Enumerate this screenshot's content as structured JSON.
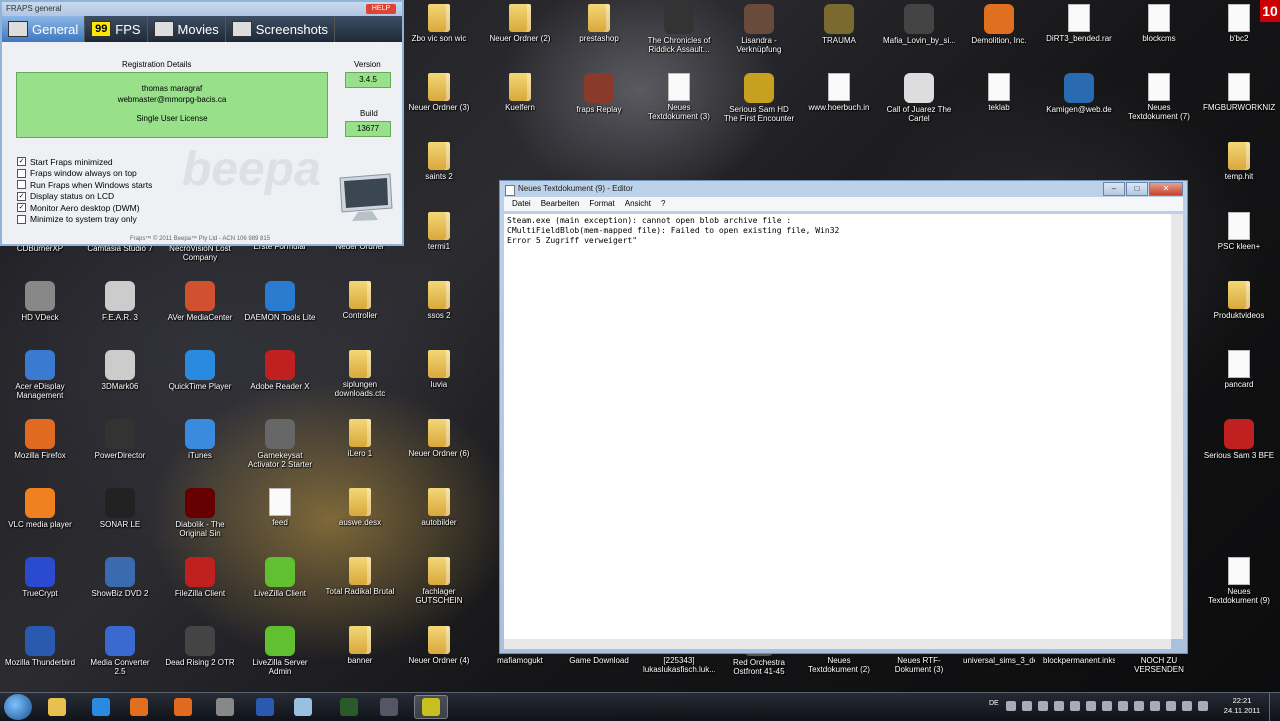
{
  "fraps": {
    "title": "FRAPS general",
    "help": "HELP",
    "version_tag": "v3.4.5",
    "tabs": [
      {
        "label": "General"
      },
      {
        "label": "FPS",
        "icon_text": "99"
      },
      {
        "label": "Movies"
      },
      {
        "label": "Screenshots"
      }
    ],
    "registration_heading": "Registration Details",
    "reg_name": "thomas maragraf",
    "reg_email": "webmaster@mmorpg-bacis.ca",
    "license": "Single User License",
    "version_label": "Version",
    "version_value": "3.4.5",
    "build_label": "Build",
    "build_value": "13677",
    "watermark": "beepa",
    "options": [
      {
        "label": "Start Fraps minimized",
        "checked": true
      },
      {
        "label": "Fraps window always on top",
        "checked": false
      },
      {
        "label": "Run Fraps when Windows starts",
        "checked": false
      },
      {
        "label": "Display status on LCD",
        "checked": true
      },
      {
        "label": "Monitor Aero desktop (DWM)",
        "checked": true
      },
      {
        "label": "Minimize to system tray only",
        "checked": false
      }
    ],
    "copyright": "Fraps™ © 2011 Beepa™ Pty Ltd - ACN 106 989 815"
  },
  "notepad": {
    "title": "Neues Textdokument (9) - Editor",
    "menu": [
      "Datei",
      "Bearbeiten",
      "Format",
      "Ansicht",
      "?"
    ],
    "lines": [
      "Steam.exe (main exception): cannot open blob archive file :",
      "CMultiFieldBlob(mem-mapped file): Failed to open existing file, Win32",
      "Error 5 Zugriff verweigert\""
    ],
    "controls": {
      "minimize": "–",
      "maximize": "□",
      "close": "✕"
    }
  },
  "desktop_icons": [
    {
      "label": "Zbo vic son wic",
      "kind": "folder"
    },
    {
      "label": "Neuer Ordner (2)",
      "kind": "folder"
    },
    {
      "label": "prestashop",
      "kind": "folder"
    },
    {
      "label": "The Chronicles of Riddick Assault...",
      "kind": "app",
      "color": "#333"
    },
    {
      "label": "Lisandra - Verknüpfung",
      "kind": "app",
      "color": "#6a4a3a"
    },
    {
      "label": "TRAUMA",
      "kind": "app",
      "color": "#7a6a30"
    },
    {
      "label": "Mafia_Lovin_by_si...",
      "kind": "app",
      "color": "#444"
    },
    {
      "label": "Demolition, Inc.",
      "kind": "app",
      "color": "#e07020"
    },
    {
      "label": "DiRT3_bended.rar",
      "kind": "doc"
    },
    {
      "label": "blockcms",
      "kind": "doc"
    },
    {
      "label": "b'bc2",
      "kind": "doc"
    },
    {
      "label": "Neuer Ordner (3)",
      "kind": "folder"
    },
    {
      "label": "Kuelfern",
      "kind": "folder"
    },
    {
      "label": "fraps Replay",
      "kind": "app",
      "color": "#8a3a2a"
    },
    {
      "label": "Neues Textdokument (3)",
      "kind": "doc"
    },
    {
      "label": "Serious Sam HD The First Encounter",
      "kind": "app",
      "color": "#c8a020"
    },
    {
      "label": "www.hoerbuch.in",
      "kind": "doc"
    },
    {
      "label": "Call of Juarez The Cartel",
      "kind": "app",
      "color": "#ddd"
    },
    {
      "label": "teklab",
      "kind": "doc"
    },
    {
      "label": "Kamigen@web.de",
      "kind": "app",
      "color": "#2a6ab0"
    },
    {
      "label": "Neues Textdokument (7)",
      "kind": "doc"
    },
    {
      "label": "FMGBURWORKNIZE...",
      "kind": "doc"
    },
    {
      "label": "saints 2",
      "kind": "folder"
    },
    {
      "label": "temp.hit",
      "kind": "folder"
    },
    {
      "label": "CDBurnerXP",
      "kind": "app",
      "color": "#555"
    },
    {
      "label": "Camtasia Studio 7",
      "kind": "app",
      "color": "#2a7a3a"
    },
    {
      "label": "NecroVisioN Lost Company",
      "kind": "app",
      "color": "#553"
    },
    {
      "label": "Erste Formular",
      "kind": "doc"
    },
    {
      "label": "Neuer Ordner",
      "kind": "folder"
    },
    {
      "label": "termi1",
      "kind": "folder"
    },
    {
      "label": "PSC kleen+",
      "kind": "doc"
    },
    {
      "label": "HD VDeck",
      "kind": "app",
      "color": "#888"
    },
    {
      "label": "F.E.A.R. 3",
      "kind": "app",
      "color": "#ccc"
    },
    {
      "label": "AVer MediaCenter",
      "kind": "app",
      "color": "#d05030"
    },
    {
      "label": "DAEMON Tools Lite",
      "kind": "app",
      "color": "#2a7ad0"
    },
    {
      "label": "Controller",
      "kind": "folder"
    },
    {
      "label": "ssos 2",
      "kind": "folder"
    },
    {
      "label": "Produktvideos",
      "kind": "folder"
    },
    {
      "label": "Acer eDisplay Management",
      "kind": "app",
      "color": "#3a7ad0"
    },
    {
      "label": "3DMark06",
      "kind": "app",
      "color": "#ccc"
    },
    {
      "label": "QuickTime Player",
      "kind": "app",
      "color": "#2a8ae0"
    },
    {
      "label": "Adobe Reader X",
      "kind": "app",
      "color": "#c02020"
    },
    {
      "label": "siplungen downloads.ctc",
      "kind": "folder"
    },
    {
      "label": "luvia",
      "kind": "folder"
    },
    {
      "label": "pancard",
      "kind": "doc"
    },
    {
      "label": "Mozilla Firefox",
      "kind": "app",
      "color": "#e06a20"
    },
    {
      "label": "PowerDirector",
      "kind": "app",
      "color": "#333"
    },
    {
      "label": "iTunes",
      "kind": "app",
      "color": "#3a8ae0"
    },
    {
      "label": "Gamekeysat Activator 2 Starter",
      "kind": "app",
      "color": "#666"
    },
    {
      "label": "iLero 1",
      "kind": "folder"
    },
    {
      "label": "Neuer Ordner (6)",
      "kind": "folder"
    },
    {
      "label": "Serious Sam 3 BFE",
      "kind": "app",
      "color": "#c02020"
    },
    {
      "label": "VLC media player",
      "kind": "app",
      "color": "#f08020"
    },
    {
      "label": "SONAR LE",
      "kind": "app",
      "color": "#222"
    },
    {
      "label": "Diabolik - The Original Sin",
      "kind": "app",
      "color": "#600"
    },
    {
      "label": "feed",
      "kind": "doc"
    },
    {
      "label": "auswe.desx",
      "kind": "folder"
    },
    {
      "label": "autobilder",
      "kind": "folder"
    },
    {
      "label": "TrueCrypt",
      "kind": "app",
      "color": "#2a4ad0"
    },
    {
      "label": "ShowBiz DVD 2",
      "kind": "app",
      "color": "#3a6ab0"
    },
    {
      "label": "FileZilla Client",
      "kind": "app",
      "color": "#c02020"
    },
    {
      "label": "LiveZilla Client",
      "kind": "app",
      "color": "#60c030"
    },
    {
      "label": "Total Radikal Brutal",
      "kind": "folder"
    },
    {
      "label": "fachlager GUTSCHEIN",
      "kind": "folder"
    },
    {
      "label": "Neues Textdokument (9)",
      "kind": "doc"
    },
    {
      "label": "Mozilla Thunderbird",
      "kind": "app",
      "color": "#2a5ab0"
    },
    {
      "label": "Media Converter 2.5",
      "kind": "app",
      "color": "#3a6ad0"
    },
    {
      "label": "Dead Rising 2 OTR",
      "kind": "app",
      "color": "#444"
    },
    {
      "label": "LiveZilla Server Admin",
      "kind": "app",
      "color": "#60c030"
    },
    {
      "label": "banner",
      "kind": "folder"
    },
    {
      "label": "Neuer Ordner (4)",
      "kind": "folder"
    },
    {
      "label": "mafiamogukt",
      "kind": "folder"
    },
    {
      "label": "Game Download",
      "kind": "folder"
    },
    {
      "label": "[225343] lukaslukasfisch.luk...",
      "kind": "doc"
    },
    {
      "label": "Red Orchestra Ostfront 41-45",
      "kind": "app",
      "color": "#555"
    },
    {
      "label": "Neues Textdokument (2)",
      "kind": "doc"
    },
    {
      "label": "Neues RTF-Dokument (3)",
      "kind": "doc"
    },
    {
      "label": "universal_sims_3_dev...",
      "kind": "doc"
    },
    {
      "label": "blockpermanent.inks",
      "kind": "doc"
    },
    {
      "label": "NOCH ZU VERSENDEN",
      "kind": "folder"
    }
  ],
  "taskbar": {
    "language": "DE",
    "time": "22:21",
    "date": "24.11.2011",
    "pinned": [
      {
        "name": "explorer",
        "color": "#e8c050"
      },
      {
        "name": "internet-explorer",
        "color": "#2a8ae0"
      },
      {
        "name": "media-player",
        "color": "#e07020"
      },
      {
        "name": "firefox",
        "color": "#e06a20"
      },
      {
        "name": "game",
        "color": "#888"
      },
      {
        "name": "thunderbird",
        "color": "#2a5ab0"
      },
      {
        "name": "notepad",
        "color": "#9ac0e0"
      },
      {
        "name": "terminal",
        "color": "#2a5a2a"
      },
      {
        "name": "steam",
        "color": "#556"
      },
      {
        "name": "fraps",
        "color": "#c8c020"
      }
    ]
  },
  "corner_badge": "10"
}
